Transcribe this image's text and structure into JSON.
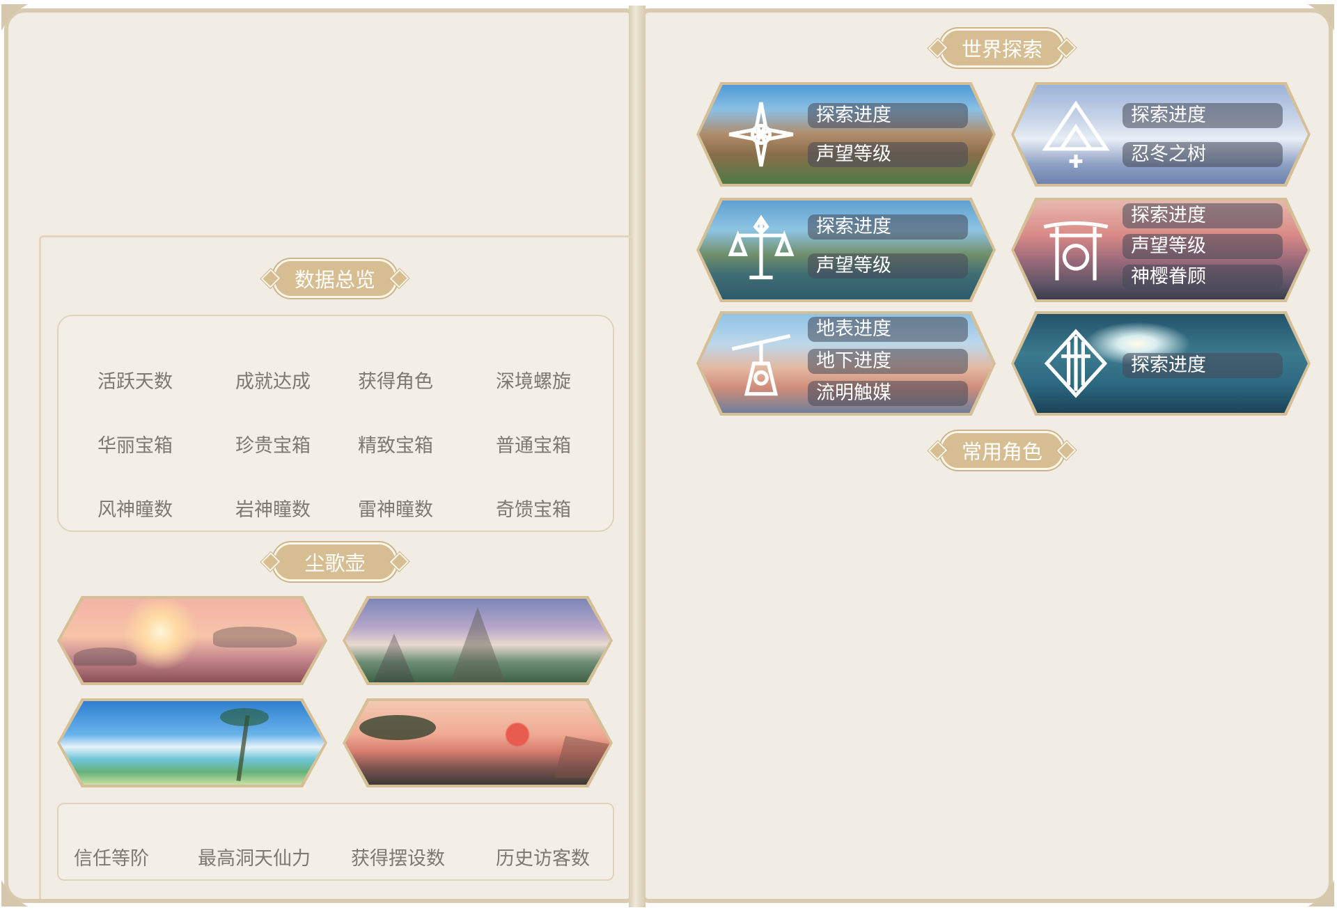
{
  "sections": {
    "overview_title": "数据总览",
    "teapot_title": "尘歌壶",
    "world_title": "世界探索",
    "characters_title": "常用角色"
  },
  "overview_stats": [
    "活跃天数",
    "成就达成",
    "获得角色",
    "深境螺旋",
    "华丽宝箱",
    "珍贵宝箱",
    "精致宝箱",
    "普通宝箱",
    "风神瞳数",
    "岩神瞳数",
    "雷神瞳数",
    "奇馈宝箱"
  ],
  "teapot_realms": [
    {
      "icon": "realm-sunset-isles"
    },
    {
      "icon": "realm-mountain-peaks"
    },
    {
      "icon": "realm-tropical-beach"
    },
    {
      "icon": "realm-pine-cliffs"
    }
  ],
  "teapot_stats": [
    "信任等阶",
    "最高洞天仙力",
    "获得摆设数",
    "历史访客数"
  ],
  "world_regions": [
    {
      "emblem": "mondstadt-emblem-icon",
      "labels": [
        "探索进度",
        "声望等级"
      ]
    },
    {
      "emblem": "dragonspine-emblem-icon",
      "labels": [
        "探索进度",
        "忍冬之树"
      ]
    },
    {
      "emblem": "liyue-emblem-icon",
      "labels": [
        "探索进度",
        "声望等级"
      ]
    },
    {
      "emblem": "inazuma-emblem-icon",
      "labels": [
        "探索进度",
        "声望等级",
        "神樱眷顾"
      ]
    },
    {
      "emblem": "chasm-emblem-icon",
      "labels": [
        "地表进度",
        "地下进度",
        "流明触媒"
      ]
    },
    {
      "emblem": "enkanomiya-emblem-icon",
      "labels": [
        "探索进度"
      ]
    }
  ],
  "colors": {
    "page": "#f1ede5",
    "tag_gold": "#d6be92",
    "text": "#7d7870"
  }
}
